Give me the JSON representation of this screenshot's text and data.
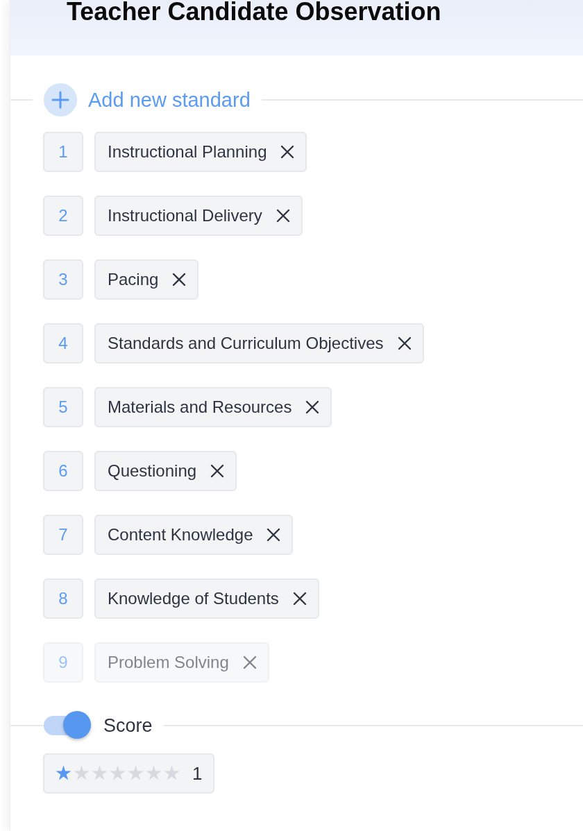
{
  "header": {
    "title": "Teacher Candidate Observation"
  },
  "add_standard": {
    "label": "Add new standard"
  },
  "standards": [
    {
      "number": "1",
      "name": "Instructional Planning",
      "faded": false
    },
    {
      "number": "2",
      "name": "Instructional Delivery",
      "faded": false
    },
    {
      "number": "3",
      "name": "Pacing",
      "faded": false
    },
    {
      "number": "4",
      "name": "Standards and Curriculum Objectives",
      "faded": false
    },
    {
      "number": "5",
      "name": "Materials and Resources",
      "faded": false
    },
    {
      "number": "6",
      "name": "Questioning",
      "faded": false
    },
    {
      "number": "7",
      "name": "Content Knowledge",
      "faded": false
    },
    {
      "number": "8",
      "name": "Knowledge of Students",
      "faded": false
    },
    {
      "number": "9",
      "name": "Problem Solving",
      "faded": true
    }
  ],
  "score": {
    "label": "Score",
    "on": true,
    "stars": 1,
    "value": "1"
  }
}
